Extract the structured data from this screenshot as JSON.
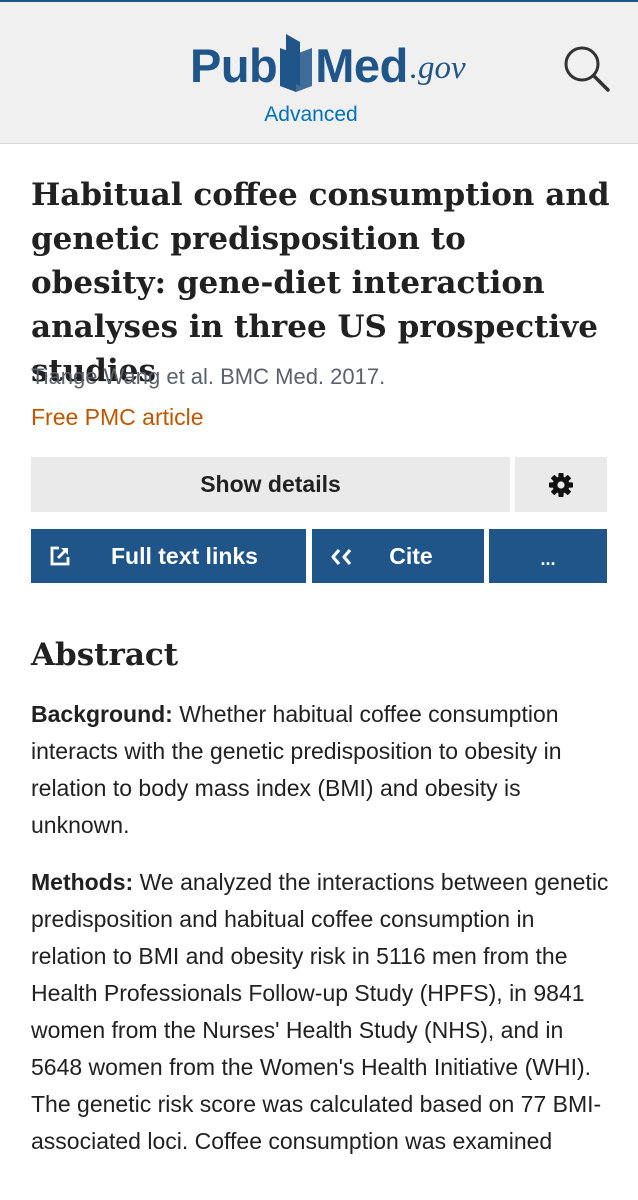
{
  "header": {
    "logo": {
      "part1": "Pub",
      "part2": "Med",
      "suffix": ".gov"
    },
    "advanced_label": "Advanced",
    "search_icon": "search-icon"
  },
  "article": {
    "title": "Habitual coffee consumption and genetic predisposition to obesity: gene-diet interaction analyses in three US prospective studies",
    "citation": "Tiange Wang et al. BMC Med. 2017.",
    "pmc_label": "Free PMC article"
  },
  "actions": {
    "show_details_label": "Show details",
    "settings_icon": "gear-icon",
    "full_text_label": "Full text links",
    "full_text_icon": "external-link-icon",
    "cite_label": "Cite",
    "cite_icon": "quote-icon",
    "more_label": "..."
  },
  "abstract": {
    "heading": "Abstract",
    "background_label": "Background:",
    "background_text": " Whether habitual coffee consumption interacts with the genetic predisposition to obesity in relation to body mass index (BMI) and obesity is unknown.",
    "methods_label": "Methods:",
    "methods_text": " We analyzed the interactions between genetic predisposition and habitual coffee consumption in relation to BMI and obesity risk in 5116 men from the Health Professionals Follow-up Study (HPFS), in 9841 women from the Nurses' Health Study (NHS), and in 5648 women from the Women's Health Initiative (WHI). The genetic risk score was calculated based on 77 BMI-associated loci. Coffee consumption was examined"
  },
  "colors": {
    "brand_blue": "#20558a",
    "link_blue": "#0071bc",
    "pmc_orange": "#c05600"
  }
}
